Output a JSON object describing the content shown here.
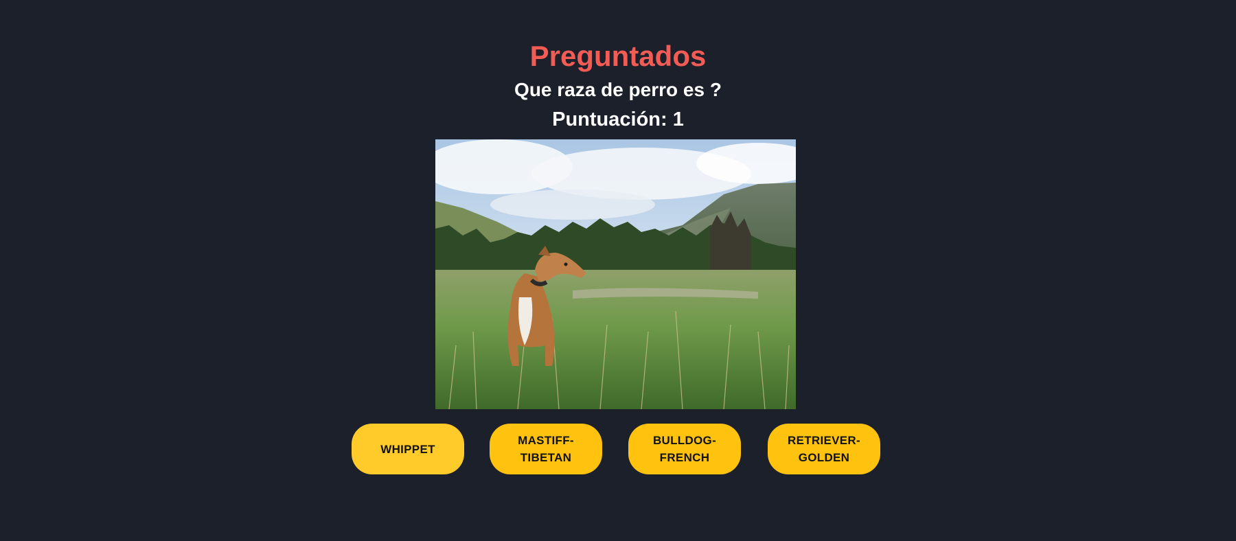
{
  "game": {
    "title": "Preguntados",
    "question": "Que raza de perro es ?",
    "score_text": "Puntuación: 1",
    "score": 1
  },
  "image": {
    "subject": "dog-photo",
    "description_icon": "dog-in-meadow"
  },
  "options": [
    {
      "label": "WHIPPET"
    },
    {
      "label": "MASTIFF-TIBETAN"
    },
    {
      "label": "BULLDOG-FRENCH"
    },
    {
      "label": "RETRIEVER-GOLDEN"
    }
  ],
  "colors": {
    "background": "#1b202b",
    "title": "#f25c54",
    "text": "#ffffff",
    "button": "#ffc20e",
    "button_text": "#111111"
  }
}
